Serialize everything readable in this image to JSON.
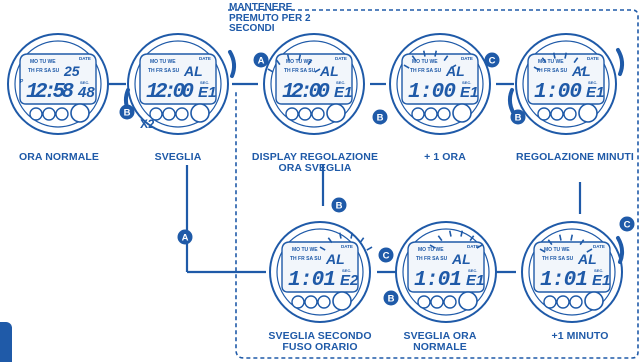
{
  "colors": {
    "primary": "#1f5aa8",
    "screen": "#f2f6fb",
    "bezel": "#ffffff"
  },
  "note": {
    "line1": "MANTENERE",
    "line2": "PREMUTO PER 2",
    "line3": "SECONDI"
  },
  "multiplier": "X2",
  "button_labels": {
    "a": "A",
    "b": "B",
    "c": "C"
  },
  "day_labels": {
    "row1": "MO TU WE",
    "row2": "TH FR SA SU",
    "date": "DATE",
    "sec": "SEC."
  },
  "watches": [
    {
      "id": "ora-normale",
      "top_digits": "25",
      "main": "12:58",
      "sec": "48",
      "pm": "P",
      "caption_lines": [
        "ORA NORMALE"
      ]
    },
    {
      "id": "sveglia",
      "top_digits": "AL",
      "main": "12:00",
      "sec": "E1",
      "pm": "",
      "caption_lines": [
        "SVEGLIA"
      ]
    },
    {
      "id": "display-regolazione",
      "top_digits": "AL",
      "main": "12:00",
      "sec": "E1",
      "pm": "",
      "caption_lines": [
        "DISPLAY REGOLAZIONE",
        "ORA SVEGLIA"
      ]
    },
    {
      "id": "piu-1-ora",
      "top_digits": "AL",
      "main": "1:00",
      "sec": "E1",
      "pm": "",
      "caption_lines": [
        "+ 1 ORA"
      ]
    },
    {
      "id": "regolazione-minuti",
      "top_digits": "AL",
      "main": "1:00",
      "sec": "E1",
      "pm": "",
      "caption_lines": [
        "REGOLAZIONE MINUTI"
      ]
    },
    {
      "id": "sveglia-secondo-fuso",
      "top_digits": "AL",
      "main": "1:01",
      "sec": "E2",
      "pm": "",
      "caption_lines": [
        "SVEGLIA SECONDO",
        "FUSO ORARIO"
      ]
    },
    {
      "id": "sveglia-ora-normale",
      "top_digits": "AL",
      "main": "1:01",
      "sec": "E1",
      "pm": "",
      "caption_lines": [
        "SVEGLIA ORA",
        "NORMALE"
      ]
    },
    {
      "id": "piu-1-minuto",
      "top_digits": "AL",
      "main": "1:01",
      "sec": "E1",
      "pm": "",
      "caption_lines": [
        "+1 MINUTO"
      ]
    }
  ]
}
